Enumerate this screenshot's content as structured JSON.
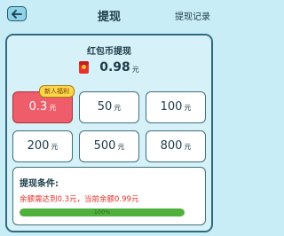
{
  "header": {
    "back_icon": "back-arrow-icon",
    "title": "提现",
    "record_link": "提现记录"
  },
  "balance": {
    "title": "红包币提现",
    "icon": "red-envelope-icon",
    "value": "0.98",
    "unit": "元"
  },
  "amounts": [
    {
      "value": "0.3",
      "unit": "元",
      "selected": true
    },
    {
      "value": "50",
      "unit": "元",
      "selected": false
    },
    {
      "value": "100",
      "unit": "元",
      "selected": false
    },
    {
      "value": "200",
      "unit": "元",
      "selected": false
    },
    {
      "value": "500",
      "unit": "元",
      "selected": false
    },
    {
      "value": "800",
      "unit": "元",
      "selected": false
    }
  ],
  "badge": "新人福利",
  "conditions": {
    "title": "提现条件:",
    "text": "余额需达到0.3元，当前余额0.99元",
    "progress_label": "100%",
    "progress": 1.0
  },
  "colors": {
    "background": "#c9edf6",
    "panel": "#7bcfe4",
    "selected": "#ef5c6a",
    "badge": "#ffd64a",
    "progress": "#4fb13c",
    "warning_text": "#e8312a"
  }
}
